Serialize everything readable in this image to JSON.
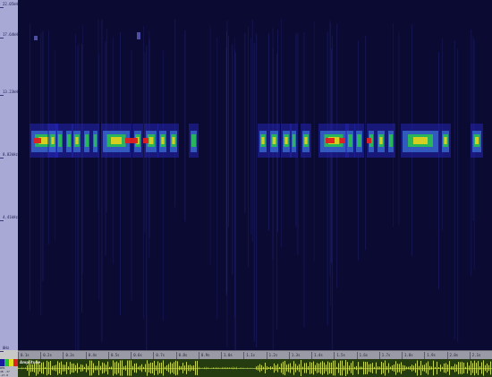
{
  "frequency_axis": {
    "labels": [
      "22.05kHz",
      "17.64kHz",
      "13.23kHz",
      "8.82kHz",
      "4.41kHz",
      "0Hz"
    ]
  },
  "time_ruler": {
    "labels": [
      "0.1s",
      "0.2s",
      "0.3s",
      "0.4s",
      "0.5s",
      "0.6s",
      "0.7s",
      "0.8s",
      "0.9s",
      "1.0s",
      "1.1s",
      "1.2s",
      "1.3s",
      "1.4s",
      "1.5s",
      "1.6s",
      "1.7s",
      "1.8s",
      "1.9s",
      "2.0s",
      "2.1s"
    ]
  },
  "waveform": {
    "label": "Amplitude"
  },
  "readout": {
    "lines": [
      "RMS",
      "dB -37",
      "-27.8"
    ]
  },
  "colors": {
    "spectrogram_bg": "#0a0a33",
    "waveform_bg": "#243c10",
    "waveform_fg": "#d8e858",
    "heat_low": "#1a1aa0",
    "heat_mid": "#20c040",
    "heat_high": "#e02020"
  }
}
